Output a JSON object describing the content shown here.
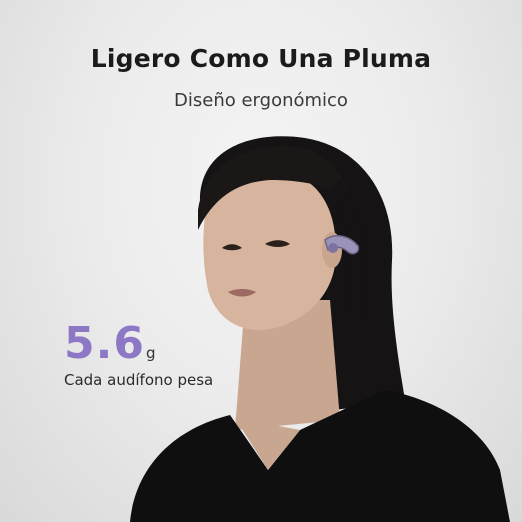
{
  "header": {
    "title": "Ligero Como Una Pluma",
    "subtitle": "Diseño ergonómico"
  },
  "stat": {
    "value": "5.6",
    "unit": "g",
    "caption": "Cada audífono pesa"
  },
  "colors": {
    "background": "#ececec",
    "accent": "#8d78c6",
    "text": "#1b1b1b"
  }
}
